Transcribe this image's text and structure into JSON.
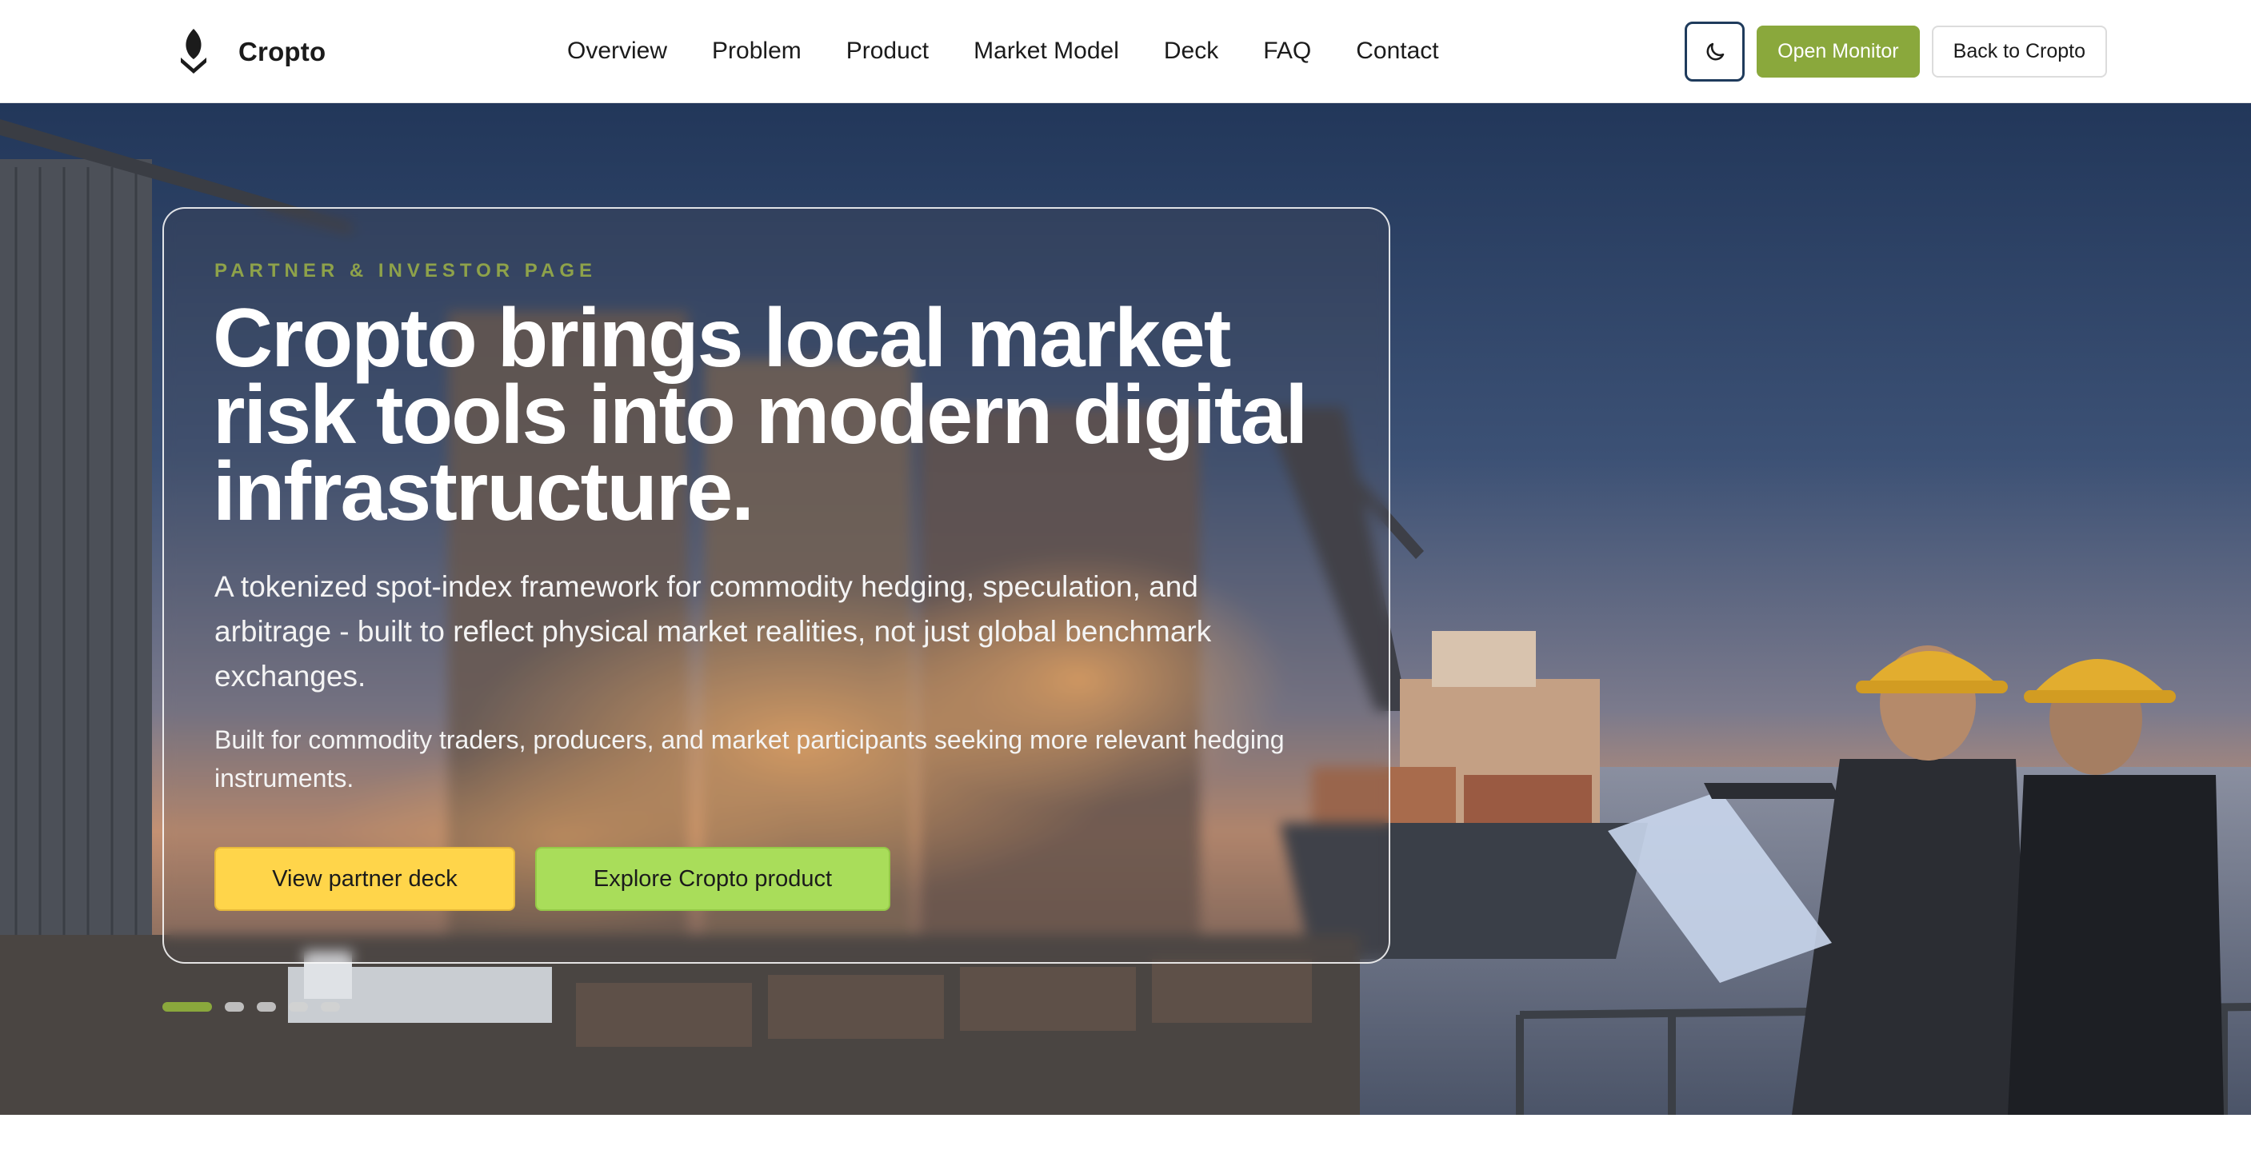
{
  "brand": {
    "name": "Cropto"
  },
  "nav": {
    "links": [
      "Overview",
      "Problem",
      "Product",
      "Market Model",
      "Deck",
      "FAQ",
      "Contact"
    ],
    "open_monitor": "Open Monitor",
    "back": "Back to Cropto",
    "theme_icon": "moon-icon"
  },
  "hero": {
    "eyebrow": "PARTNER & INVESTOR PAGE",
    "headline": "Cropto brings local market risk tools into modern digital infrastructure.",
    "lead": "A tokenized spot-index framework for commodity hedging, speculation, and arbitrage - built to reflect physical market realities, not just global benchmark exchanges.",
    "sub": "Built for commodity traders, producers, and market participants seeking more relevant hedging instruments.",
    "cta_primary": "View partner deck",
    "cta_secondary": "Explore Cropto product",
    "slides_total": 5,
    "slide_active": 1
  },
  "colors": {
    "accent_green": "#8aa83c",
    "cta_yellow": "#ffd54a",
    "cta_lime": "#a9dd5a"
  }
}
